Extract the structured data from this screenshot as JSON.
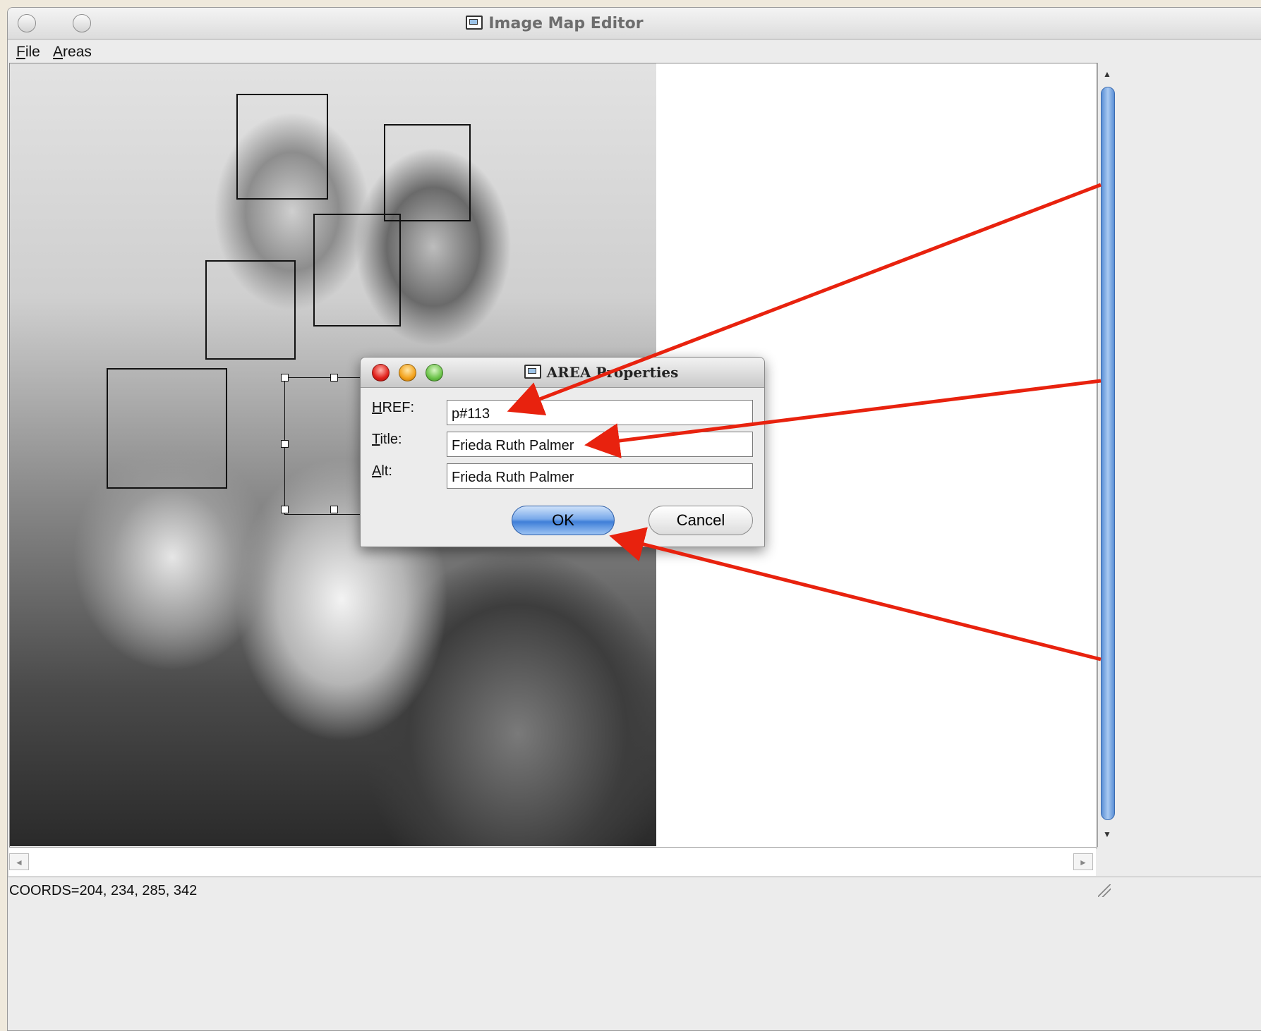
{
  "window": {
    "title": "Image Map Editor"
  },
  "menu": {
    "file": "File",
    "file_rest": "ile",
    "file_mnemonic": "F",
    "areas": "Areas",
    "areas_mnemonic": "A",
    "areas_rest": "reas"
  },
  "status": {
    "coords": "COORDS=204, 234, 285, 342"
  },
  "dialog": {
    "title": "AREA Properties",
    "href_label_mnemonic": "H",
    "href_label_rest": "REF:",
    "title_label_mnemonic": "T",
    "title_label_rest": "itle:",
    "alt_label_mnemonic": "A",
    "alt_label_rest": "lt:",
    "href_value": "p#113",
    "title_value": "Frieda Ruth Palmer",
    "alt_value": "Frieda Ruth Palmer",
    "ok_label": "OK",
    "cancel_label": "Cancel"
  },
  "icons": [
    "app-icon",
    "scroll-up-icon",
    "scroll-down-icon",
    "scroll-left-icon",
    "scroll-right-icon",
    "resize-grip-icon"
  ],
  "colors": {
    "annotation_arrow": "#e8220e",
    "ok_button": "#4a86dc"
  }
}
